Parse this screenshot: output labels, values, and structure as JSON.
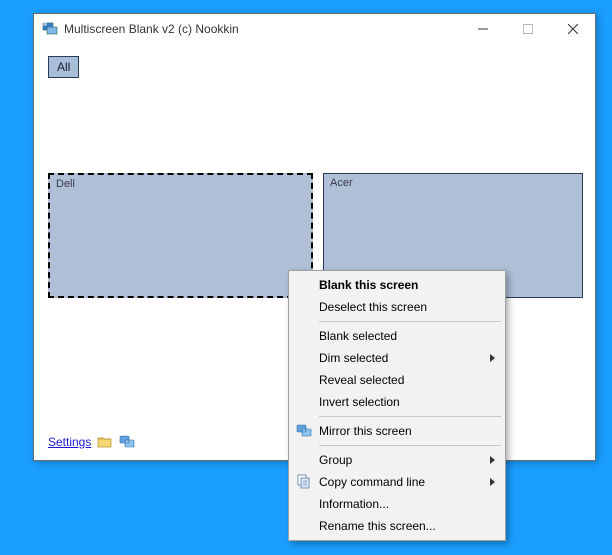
{
  "titlebar": {
    "title": "Multiscreen Blank v2 (c) Nookkin"
  },
  "toolbar": {
    "all_label": "All"
  },
  "monitors": {
    "dell_label": "Dell",
    "acer_label": "Acer"
  },
  "footer": {
    "settings_label": "Settings"
  },
  "context_menu": {
    "blank_this": "Blank this screen",
    "deselect_this": "Deselect this screen",
    "blank_selected": "Blank selected",
    "dim_selected": "Dim selected",
    "reveal_selected": "Reveal selected",
    "invert_selection": "Invert selection",
    "mirror_this": "Mirror this screen",
    "group": "Group",
    "copy_cmd": "Copy command line",
    "information": "Information...",
    "rename": "Rename this screen..."
  }
}
